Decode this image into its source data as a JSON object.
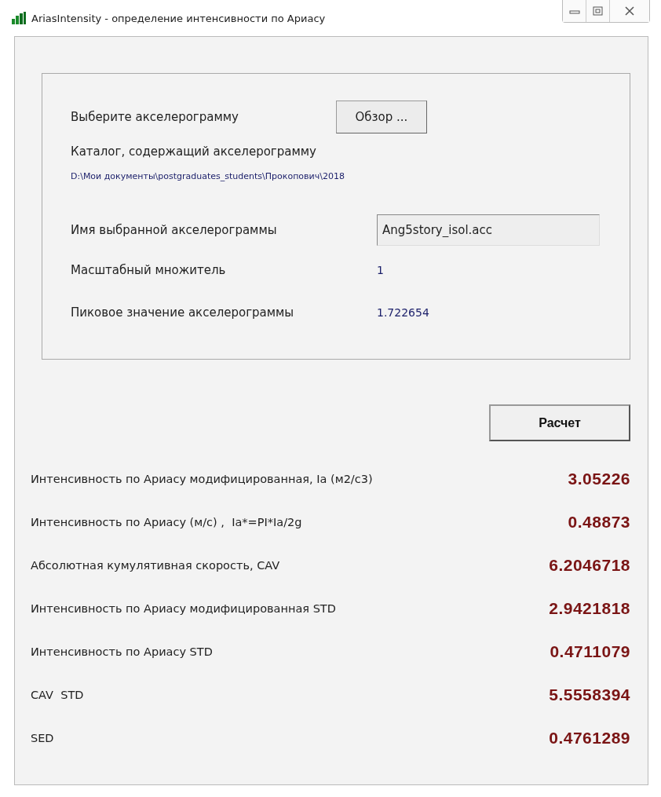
{
  "window": {
    "title": "AriasIntensity - определение интенсивности по Ариасу"
  },
  "input_group": {
    "choose_label": "Выберите акселерограмму",
    "browse_button": "Обзор ...",
    "catalog_label": "Каталог, содержащий акселерограмму",
    "catalog_path": "D:\\Мои документы\\postgraduates_students\\Прокопович\\2018",
    "file_label": "Имя выбранной акселерограммы",
    "file_value": "Ang5story_isol.acc",
    "scale_label": "Масштабный множитель",
    "scale_value": "1",
    "peak_label": "Пиковое значение акселерограммы",
    "peak_value": "1.722654"
  },
  "calculate_button": "Расчет",
  "results": [
    {
      "label": "Интенсивность по Ариасу модифицированная, Ia (м2/с3)",
      "value": "3.05226"
    },
    {
      "label": "Интенсивность по Ариасу (м/с) ,  Ia*=PI*Ia/2g",
      "value": "0.48873"
    },
    {
      "label": "Абсолютная кумулятивная скорость, CAV",
      "value": "6.2046718"
    },
    {
      "label": "Интенсивность по Ариасу модифицированная STD",
      "value": "2.9421818"
    },
    {
      "label": "Интенсивность по Ариасу STD",
      "value": "0.4711079"
    },
    {
      "label": "CAV  STD",
      "value": "5.5558394"
    },
    {
      "label": "SED",
      "value": "0.4761289"
    }
  ]
}
